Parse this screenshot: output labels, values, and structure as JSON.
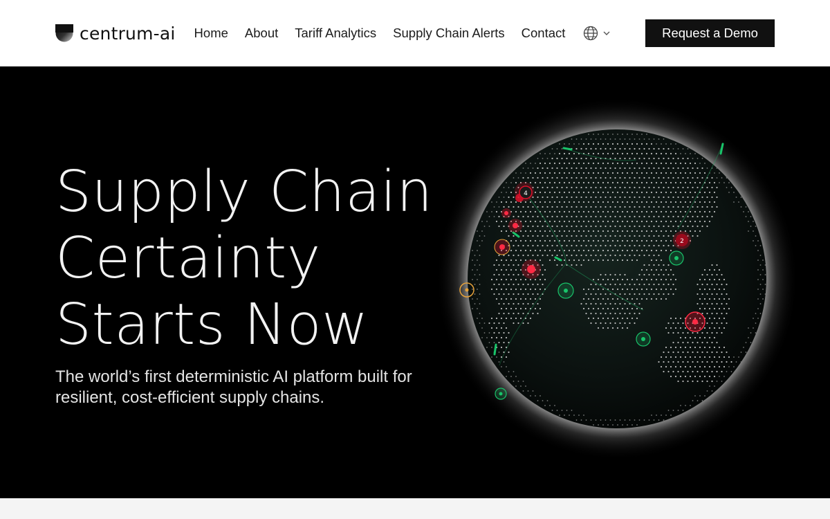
{
  "brand": {
    "name": "centrum-ai",
    "logo_icon": "centrum-logo-icon"
  },
  "nav": {
    "links": [
      {
        "label": "Home"
      },
      {
        "label": "About"
      },
      {
        "label": "Tariff Analytics"
      },
      {
        "label": "Supply Chain Alerts"
      },
      {
        "label": "Contact"
      }
    ],
    "language_icon": "globe-icon",
    "dropdown_icon": "chevron-down-icon",
    "cta_label": "Request a Demo"
  },
  "hero": {
    "title_lines": [
      "Supply Chain",
      "Certainty",
      "Starts Now"
    ],
    "subtitle": "The world’s first deterministic AI platform built for resilient, cost-efficient supply chains.",
    "globe": {
      "icon": "globe-visualization",
      "alert_counts": [
        "4",
        "2"
      ],
      "colors": {
        "alert": "#e0102a",
        "ok": "#19c46a",
        "warning": "#e8a33a",
        "dots": "#d9d9d9"
      }
    }
  }
}
